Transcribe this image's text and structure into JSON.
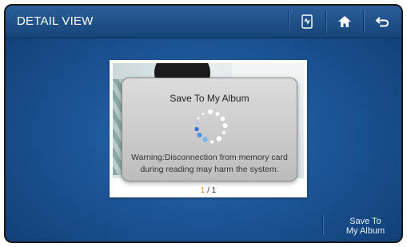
{
  "header": {
    "title": "DETAIL VIEW",
    "icons": [
      "memo-icon",
      "home-icon",
      "back-icon"
    ]
  },
  "viewer": {
    "page_current": "1",
    "page_separator": " / ",
    "page_total": "1"
  },
  "dialog": {
    "title": "Save To My Album",
    "message_line1": "Warning:Disconnection from memory card",
    "message_line2": "during reading may harm the system."
  },
  "footer": {
    "save_label_line1": "Save To",
    "save_label_line2": "My Album"
  },
  "colors": {
    "accent_orange": "#f28a1a",
    "bar_blue": "#164477"
  }
}
